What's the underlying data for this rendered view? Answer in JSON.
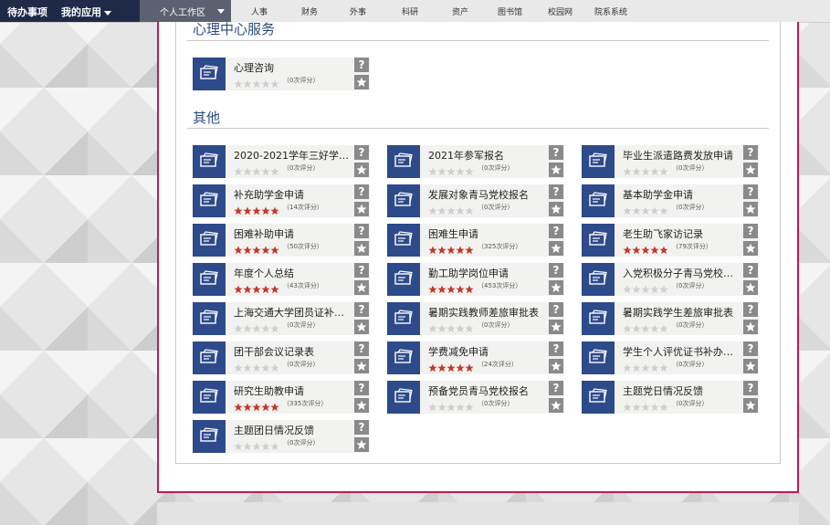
{
  "nav": {
    "todo": "待办事项",
    "myapps": "我的应用",
    "active_tab": "个人工作区",
    "tabs": [
      "人事",
      "财务",
      "外事",
      "科研",
      "资产",
      "图书馆",
      "校园网",
      "院系系统"
    ]
  },
  "colors": {
    "accent": "#2d4a8a",
    "star_on": "#c0392b",
    "star_off": "#cfcfcf",
    "frame": "#c2185b"
  },
  "sections": [
    {
      "title": "心理中心服务",
      "cards": [
        {
          "title": "心理咨询",
          "stars": 0,
          "rating": "（0次评分）"
        }
      ]
    },
    {
      "title": "其他",
      "cards": [
        {
          "title": "2020-2021学年三好学…",
          "stars": 0,
          "rating": "（0次评分）"
        },
        {
          "title": "2021年参军报名",
          "stars": 0,
          "rating": "（0次评分）"
        },
        {
          "title": "毕业生派遣路费发放申请",
          "stars": 0,
          "rating": "（0次评分）"
        },
        {
          "title": "补充助学金申请",
          "stars": 5,
          "rating": "（14次评分）"
        },
        {
          "title": "发展对象青马党校报名",
          "stars": 0,
          "rating": "（0次评分）"
        },
        {
          "title": "基本助学金申请",
          "stars": 0,
          "rating": "（0次评分）"
        },
        {
          "title": "困难补助申请",
          "stars": 5,
          "rating": "（50次评分）"
        },
        {
          "title": "困难生申请",
          "stars": 5,
          "rating": "（325次评分）"
        },
        {
          "title": "老生助飞家访记录",
          "stars": 5,
          "rating": "（79次评分）"
        },
        {
          "title": "年度个人总结",
          "stars": 5,
          "rating": "（43次评分）"
        },
        {
          "title": "勤工助学岗位申请",
          "stars": 5,
          "rating": "（453次评分）"
        },
        {
          "title": "入党积极分子青马党校…",
          "stars": 0,
          "rating": "（0次评分）"
        },
        {
          "title": "上海交通大学团员证补…",
          "stars": 0,
          "rating": "（0次评分）"
        },
        {
          "title": "暑期实践教师差旅审批表",
          "stars": 0,
          "rating": "（0次评分）"
        },
        {
          "title": "暑期实践学生差旅审批表",
          "stars": 0,
          "rating": "（0次评分）"
        },
        {
          "title": "团干部会议记录表",
          "stars": 0,
          "rating": "（0次评分）"
        },
        {
          "title": "学费减免申请",
          "stars": 5,
          "rating": "（24次评分）"
        },
        {
          "title": "学生个人评优证书补办…",
          "stars": 0,
          "rating": "（0次评分）"
        },
        {
          "title": "研究生助教申请",
          "stars": 5,
          "rating": "（335次评分）"
        },
        {
          "title": "预备党员青马党校报名",
          "stars": 0,
          "rating": "（0次评分）"
        },
        {
          "title": "主题党日情况反馈",
          "stars": 0,
          "rating": "（0次评分）"
        },
        {
          "title": "主题团日情况反馈",
          "stars": 0,
          "rating": "（0次评分）"
        }
      ]
    }
  ],
  "help_glyph": "?"
}
